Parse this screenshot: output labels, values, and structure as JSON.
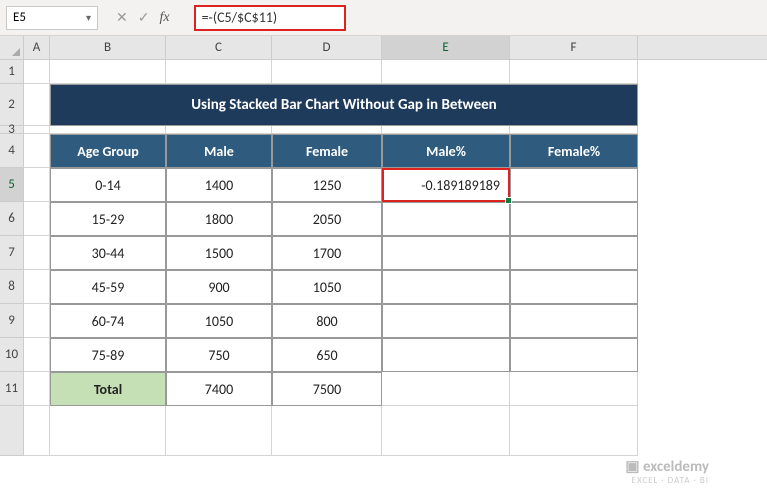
{
  "name_box": "E5",
  "formula": "=-(C5/$C$11)",
  "fx_label": "fx",
  "columns": {
    "A": "A",
    "B": "B",
    "C": "C",
    "D": "D",
    "E": "E",
    "F": "F"
  },
  "rows": [
    "1",
    "2",
    "3",
    "4",
    "5",
    "6",
    "7",
    "8",
    "9",
    "10",
    "11"
  ],
  "title": "Using Stacked Bar Chart Without Gap in Between",
  "headers": {
    "age": "Age Group",
    "male": "Male",
    "female": "Female",
    "malep": "Male%",
    "femalep": "Female%"
  },
  "data": [
    {
      "age": "0-14",
      "male": "1400",
      "female": "1250",
      "malep": "-0.189189189",
      "femalep": ""
    },
    {
      "age": "15-29",
      "male": "1800",
      "female": "2050",
      "malep": "",
      "femalep": ""
    },
    {
      "age": "30-44",
      "male": "1500",
      "female": "1700",
      "malep": "",
      "femalep": ""
    },
    {
      "age": "45-59",
      "male": "900",
      "female": "1050",
      "malep": "",
      "femalep": ""
    },
    {
      "age": "60-74",
      "male": "1050",
      "female": "800",
      "malep": "",
      "femalep": ""
    },
    {
      "age": "75-89",
      "male": "750",
      "female": "650",
      "malep": "",
      "femalep": ""
    }
  ],
  "total": {
    "label": "Total",
    "male": "7400",
    "female": "7500"
  },
  "brand": {
    "l1": "exceldemy",
    "l2": "EXCEL · DATA · BI"
  }
}
